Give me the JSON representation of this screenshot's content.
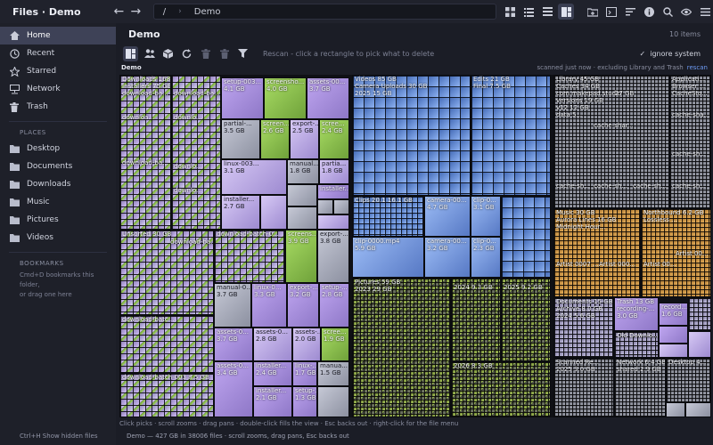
{
  "window": {
    "title": "Files · Demo"
  },
  "path": {
    "root": "/",
    "current": "Demo"
  },
  "sidebar": {
    "items": [
      {
        "label": "Home",
        "icon": "home-icon",
        "active": true
      },
      {
        "label": "Recent",
        "icon": "clock-icon"
      },
      {
        "label": "Starred",
        "icon": "star-icon"
      },
      {
        "label": "Network",
        "icon": "network-icon"
      },
      {
        "label": "Trash",
        "icon": "trash-icon"
      }
    ],
    "places_header": "PLACES",
    "places": [
      {
        "label": "Desktop",
        "icon": "folder-icon"
      },
      {
        "label": "Documents",
        "icon": "folder-icon"
      },
      {
        "label": "Downloads",
        "icon": "folder-icon"
      },
      {
        "label": "Music",
        "icon": "folder-icon"
      },
      {
        "label": "Pictures",
        "icon": "folder-icon"
      },
      {
        "label": "Videos",
        "icon": "folder-icon"
      }
    ],
    "bookmarks_header": "BOOKMARKS",
    "bookmarks_hint_1": "Cmd+D bookmarks this folder,",
    "bookmarks_hint_2": "or drag one here",
    "footer": "Ctrl+H  Show hidden files"
  },
  "main": {
    "title": "Demo",
    "item_count": "10 items",
    "rescan_hint": "Rescan - click a rectangle to pick what to delete",
    "ignore_label": "ignore system",
    "crumb": "Demo",
    "scan_info": "scanned just now · excluding Library and Trash",
    "rescan_link": "rescan"
  },
  "treemap": {
    "downloads": {
      "label": "Downloads 168 GB",
      "sub": "Installers 75 GB"
    },
    "setup1": {
      "label": "setup-003...",
      "size": "4.1 GB"
    },
    "screenshot1": {
      "label": "screensho...",
      "size": "4.0 GB"
    },
    "assets1": {
      "label": "assets-00...",
      "size": "3.7 GB"
    },
    "partial1": {
      "label": "partial-...",
      "size": "3.5 GB"
    },
    "screen2": {
      "label": "screen...",
      "size": "2.6 GB"
    },
    "export1": {
      "label": "export-...",
      "size": "2.5 GB"
    },
    "screen3": {
      "label": "scree...",
      "size": "2.4 GB"
    },
    "linux1": {
      "label": "linux-003...",
      "size": "3.1 GB"
    },
    "manual1": {
      "label": "manual...",
      "size": "1.8 GB"
    },
    "partia2": {
      "label": "partia...",
      "size": "1.8 GB"
    },
    "installer1": {
      "label": "installer...",
      "size": ""
    },
    "installer2": {
      "label": "installer...",
      "size": "2.7 GB"
    },
    "dlbat1": {
      "label": "download-ba..."
    },
    "dlbat2": {
      "label": "downloa..."
    },
    "dlbat3": {
      "label": "download-ba..."
    },
    "dlbat4": {
      "label": "downlo..."
    },
    "unsorted": {
      "label": "Unsorted  30 GB"
    },
    "dlbat5": {
      "label": "download-ba..."
    },
    "dlbatch6": {
      "label": "download-batch-0..."
    },
    "screens4": {
      "label": "screens...",
      "size": "3.9 GB"
    },
    "export2": {
      "label": "export-...",
      "size": "3.8 GB"
    },
    "manual2": {
      "label": "manual-0...",
      "size": "3.7 GB"
    },
    "linux2": {
      "label": "linux-0...",
      "size": "3.3 GB"
    },
    "export3": {
      "label": "export-...",
      "size": "3.2 GB"
    },
    "setup2": {
      "label": "setup-...",
      "size": "2.8 GB"
    },
    "assets2": {
      "label": "assets-0...",
      "size": "3.7 GB"
    },
    "assets3": {
      "label": "assets-0...",
      "size": "2.8 GB"
    },
    "assets4": {
      "label": "assets-...",
      "size": "2.0 GB"
    },
    "scree5": {
      "label": "scree...",
      "size": "1.9 GB"
    },
    "assets5": {
      "label": "assets-0...",
      "size": "3.4 GB"
    },
    "installer3": {
      "label": "installer...",
      "size": "2.4 GB"
    },
    "linux3": {
      "label": "linux-...",
      "size": "1.7 GB"
    },
    "manua3": {
      "label": "manua...",
      "size": "1.5 GB"
    },
    "installer4": {
      "label": "installer...",
      "size": "2.1 GB"
    },
    "setup3": {
      "label": "setup-...",
      "size": "1.3 GB"
    },
    "dlbatch8": {
      "label": "download-batch-003  8.5 GB"
    },
    "dlbat9": {
      "label": "download-batc..."
    },
    "videos": {
      "label": "Videos  85 GB",
      "sub": "Camera Uploads  30 GB",
      "sub2": "2025  15 GB"
    },
    "edits": {
      "label": "Edits  21 GB",
      "sub": "Final  7.5 GB"
    },
    "clips": {
      "label": "Clips  20.1  16.1 GB"
    },
    "camera1": {
      "label": "camera-00...",
      "size": "4.7 GB"
    },
    "clip1": {
      "label": "clip-0...",
      "size": "3.1 GB"
    },
    "clip0000": {
      "label": "clip-0000.mp4",
      "size": "5.9 GB"
    },
    "camera2": {
      "label": "camera-00...",
      "size": "3.2 GB"
    },
    "clip2": {
      "label": "clip-0...",
      "size": "2.3 GB"
    },
    "pictures": {
      "label": "Pictures  59 GB",
      "sub": "2023  29 GB"
    },
    "pic2024": {
      "label": "2024  9.3 GB"
    },
    "pic2025": {
      "label": "2025  9.2 GB"
    },
    "pic2026": {
      "label": "2026  8.3 GB"
    },
    "library": {
      "label": "Library  45 GB",
      "l2": "Caches  34 GB",
      "l3": "com.makepad.studio",
      "l4": "versions  19 GB",
      "l5": "v12  12 GB",
      "l6": "data  5..."
    },
    "applic": {
      "label": "Applicati...",
      "l2": "Browser ...",
      "l3": "CacheSto..."
    },
    "caches27": {
      "label": "27 GB"
    },
    "cachesha1": {
      "label": "cache-shar..."
    },
    "cachesha2": {
      "label": "cache-sha..."
    },
    "cachesh3": {
      "label": "cache-sh..."
    },
    "cachesh4": {
      "label": "cache-sh..."
    },
    "cachesh5": {
      "label": "cache-sh..."
    },
    "cachesh6": {
      "label": "cache-sh..."
    },
    "music": {
      "label": "Music  30 GB",
      "l2": "Aurora Lines  16 GB",
      "l3": "Midnight Hour..."
    },
    "northbound": {
      "label": "Northbound  6.2 GB",
      "l2": "Lossless ..."
    },
    "artist1": {
      "label": "Artist 00..."
    },
    "artist2": {
      "label": "Artist 0007 ..."
    },
    "artist3": {
      "label": "Artist 000..."
    },
    "documents": {
      "label": "Documents  15 GB",
      "l2": "Archive  8.0 GB",
      "l3": "2024  5.6 GB"
    },
    "trash": {
      "label": "Trash  13 GB",
      "l2": "recording-...",
      "l3": "3.0 GB"
    },
    "record2": {
      "label": "record...",
      "size": "1.6 GB"
    },
    "olddown": {
      "label": "Old Downlo..."
    },
    "scanned": {
      "label": "Scanned Re...",
      "l2": "2025  3.0 GB"
    },
    "network": {
      "label": "Network  6.4 GB",
      "l2": "shared  2.9 GB"
    },
    "desktop": {
      "label": "Desktop  4..."
    }
  },
  "hints": "Click picks · scroll zooms · drag pans · double-click fills the view · Esc backs out · right-click for the file menu",
  "status": "Demo — 427 GB in 38006 files · scroll zooms, drag pans, Esc backs out"
}
